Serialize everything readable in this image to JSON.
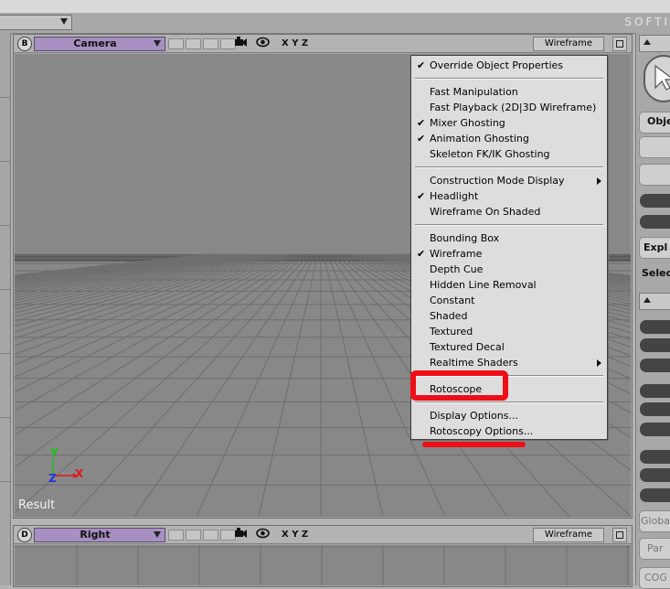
{
  "app": {
    "brand": "SOFTI"
  },
  "viewports": {
    "top": {
      "letter": "B",
      "camera": "Camera",
      "axes": "X Y Z",
      "mode": "Wireframe"
    },
    "bottom": {
      "letter": "D",
      "camera": "Right",
      "axes": "X Y Z",
      "mode": "Wireframe"
    }
  },
  "menu": {
    "groups": [
      [
        {
          "label": "Override Object Properties",
          "checked": true
        }
      ],
      [
        {
          "label": "Fast Manipulation",
          "checked": false
        },
        {
          "label": "Fast Playback (2D|3D Wireframe)",
          "checked": false
        },
        {
          "label": "Mixer Ghosting",
          "checked": true
        },
        {
          "label": "Animation Ghosting",
          "checked": true
        },
        {
          "label": "Skeleton FK/IK Ghosting",
          "checked": false
        }
      ],
      [
        {
          "label": "Construction Mode Display",
          "checked": false,
          "submenu": true
        },
        {
          "label": "Headlight",
          "checked": true
        },
        {
          "label": "Wireframe On Shaded",
          "checked": false
        }
      ],
      [
        {
          "label": "Bounding Box",
          "checked": false
        },
        {
          "label": "Wireframe",
          "checked": true
        },
        {
          "label": "Depth Cue",
          "checked": false
        },
        {
          "label": "Hidden Line Removal",
          "checked": false
        },
        {
          "label": "Constant",
          "checked": false
        },
        {
          "label": "Shaded",
          "checked": false
        },
        {
          "label": "Textured",
          "checked": false
        },
        {
          "label": "Textured Decal",
          "checked": false
        },
        {
          "label": "Realtime Shaders",
          "checked": false,
          "submenu": true
        }
      ],
      [
        {
          "label": "Rotoscope",
          "checked": false
        }
      ],
      [
        {
          "label": "Display Options...",
          "checked": false
        },
        {
          "label": "Rotoscopy Options...",
          "checked": false
        }
      ]
    ]
  },
  "canvas": {
    "label": "Result",
    "axis": {
      "y": "Y",
      "z": "Z",
      "x": "X"
    }
  },
  "right_panel": {
    "labels": {
      "obj": "Obje",
      "expl": "Expl",
      "select": "Selec",
      "global": "Globa",
      "par": "Par",
      "cog": "COG"
    }
  },
  "colors": {
    "annotation": "#ee0e17",
    "camera_combo": "#a78fc1",
    "viewport_bg": "#888888",
    "axis_y": "#15c415",
    "axis_z": "#2236e0",
    "axis_x": "#e0181b"
  }
}
